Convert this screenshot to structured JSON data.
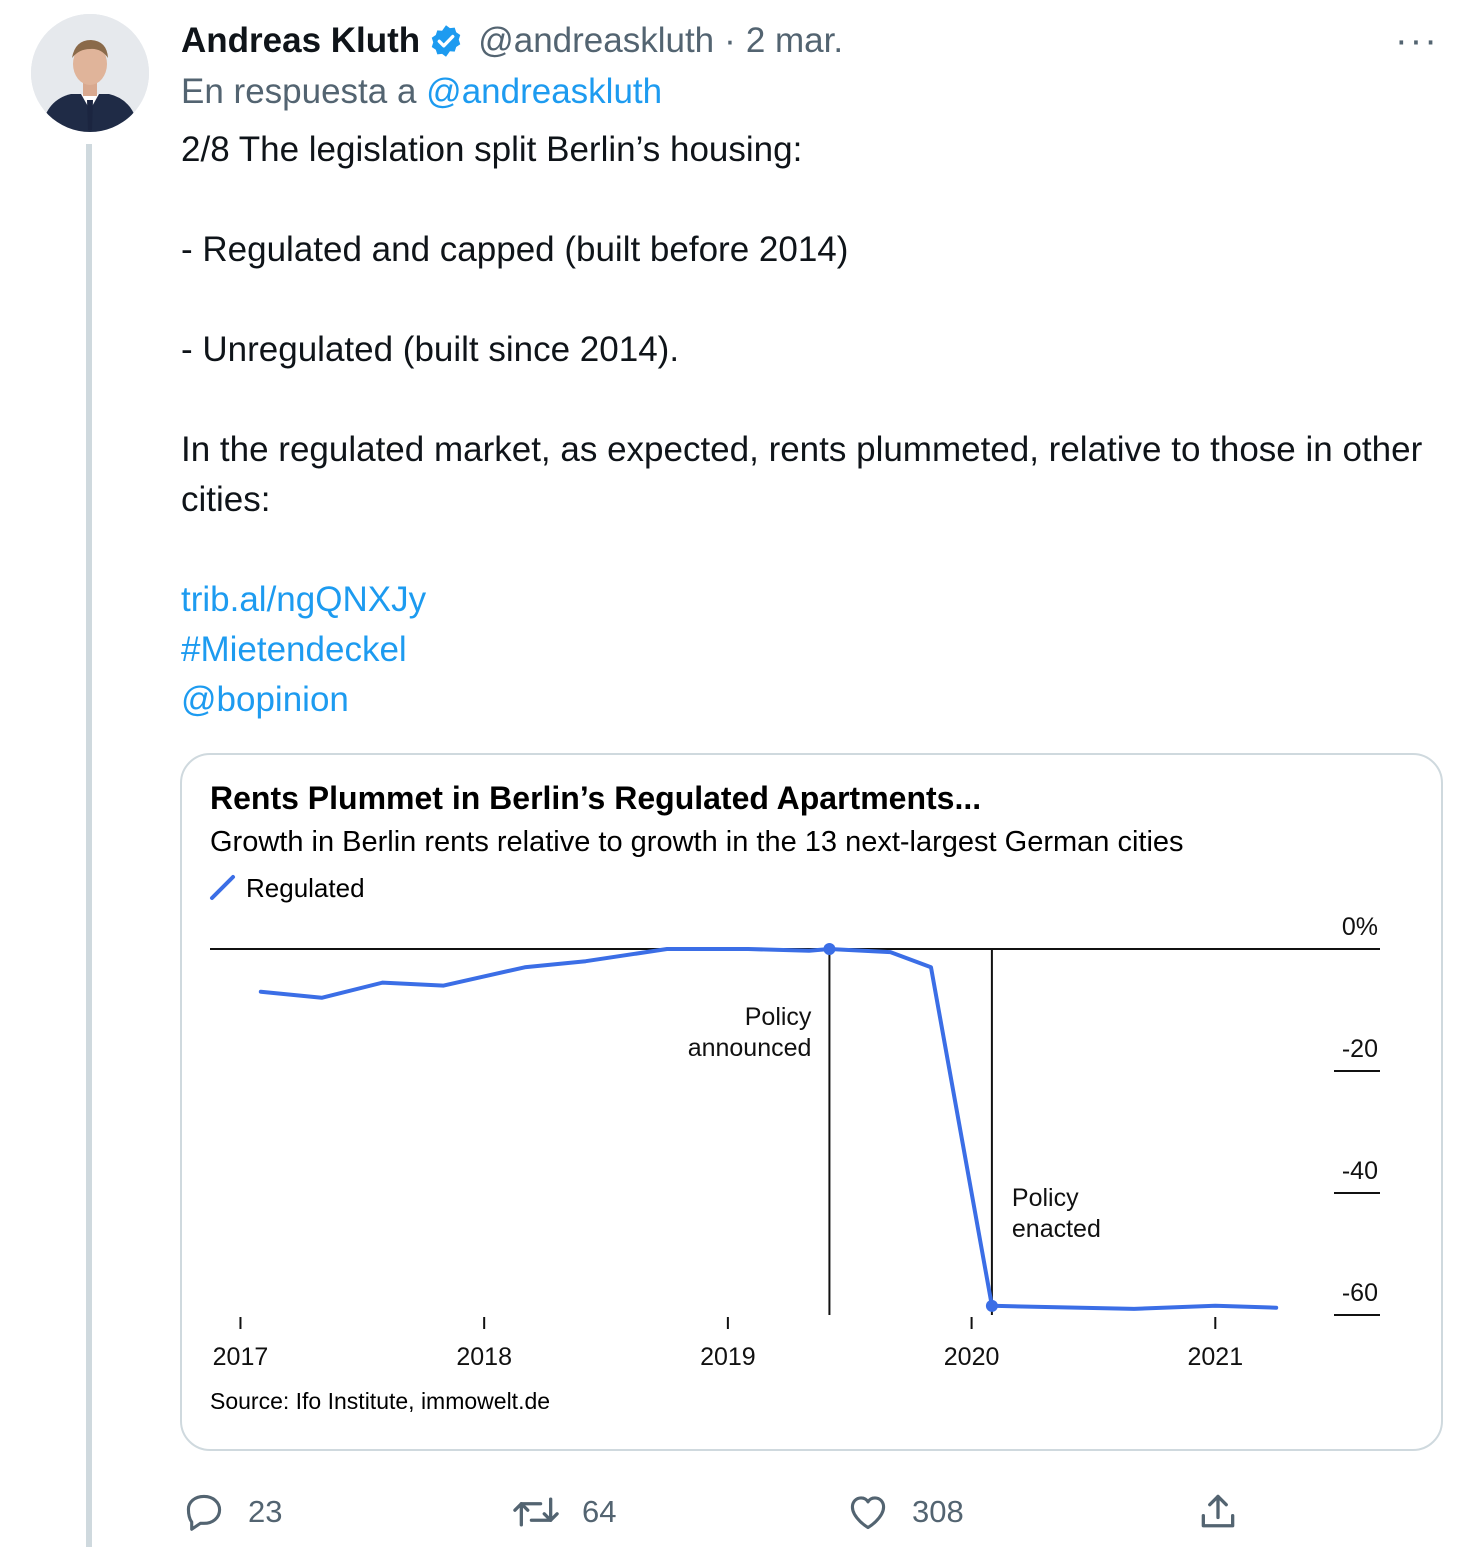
{
  "tweet": {
    "author_name": "Andreas Kluth",
    "handle": "@andreaskluth",
    "separator": "·",
    "date": "2 mar.",
    "reply_prefix": "En respuesta a",
    "reply_handle": "@andreaskluth",
    "text_lines": [
      "2/8 The legislation split Berlin’s housing:",
      "- Regulated and capped (built before 2014)",
      "- Unregulated (built since 2014).",
      "In the regulated market, as expected, rents plummeted, relative to those in other cities:"
    ],
    "link": "trib.al/ngQNXJy",
    "hashtag": "#Mietendeckel",
    "mention": "@bopinion",
    "more_label": "···"
  },
  "actions": {
    "replies": "23",
    "retweets": "64",
    "likes": "308"
  },
  "icons": {
    "verified": "verified-badge-icon",
    "reply": "reply-icon",
    "retweet": "retweet-icon",
    "like": "heart-icon",
    "share": "share-icon"
  },
  "colors": {
    "link": "#1d9bf0",
    "muted": "#536471",
    "series": "#3b6ee6"
  },
  "chart_data": {
    "type": "line",
    "title": "Rents Plummet in Berlin’s Regulated Apartments...",
    "subtitle": "Growth in Berlin rents relative to growth in the 13 next-largest German cities",
    "source": "Source: Ifo Institute, immowelt.de",
    "legend_position": "top-left",
    "series": [
      {
        "name": "Regulated",
        "points": [
          {
            "x": "2017-02",
            "y": -7
          },
          {
            "x": "2017-05",
            "y": -8
          },
          {
            "x": "2017-08",
            "y": -5.5
          },
          {
            "x": "2017-11",
            "y": -6
          },
          {
            "x": "2018-03",
            "y": -3
          },
          {
            "x": "2018-06",
            "y": -2
          },
          {
            "x": "2018-10",
            "y": 0
          },
          {
            "x": "2019-02",
            "y": 0
          },
          {
            "x": "2019-05",
            "y": -0.3
          },
          {
            "x": "2019-06",
            "y": 0
          },
          {
            "x": "2019-09",
            "y": -0.5
          },
          {
            "x": "2019-11",
            "y": -3
          },
          {
            "x": "2020-02",
            "y": -58.5
          },
          {
            "x": "2020-09",
            "y": -59
          },
          {
            "x": "2021-01",
            "y": -58.5
          },
          {
            "x": "2021-04",
            "y": -58.8
          }
        ]
      }
    ],
    "markers": [
      {
        "x": "2019-06",
        "y": 0
      },
      {
        "x": "2020-02",
        "y": -58.5
      }
    ],
    "annotations": [
      {
        "x": "2019-06",
        "label_line1": "Policy",
        "label_line2": "announced"
      },
      {
        "x": "2020-02",
        "label_line1": "Policy",
        "label_line2": "enacted"
      }
    ],
    "x_ticks": [
      "2017",
      "2018",
      "2019",
      "2020",
      "2021"
    ],
    "y_ticks": [
      "0%",
      "-20",
      "-40",
      "-60"
    ],
    "ylim": [
      -60,
      0
    ]
  }
}
